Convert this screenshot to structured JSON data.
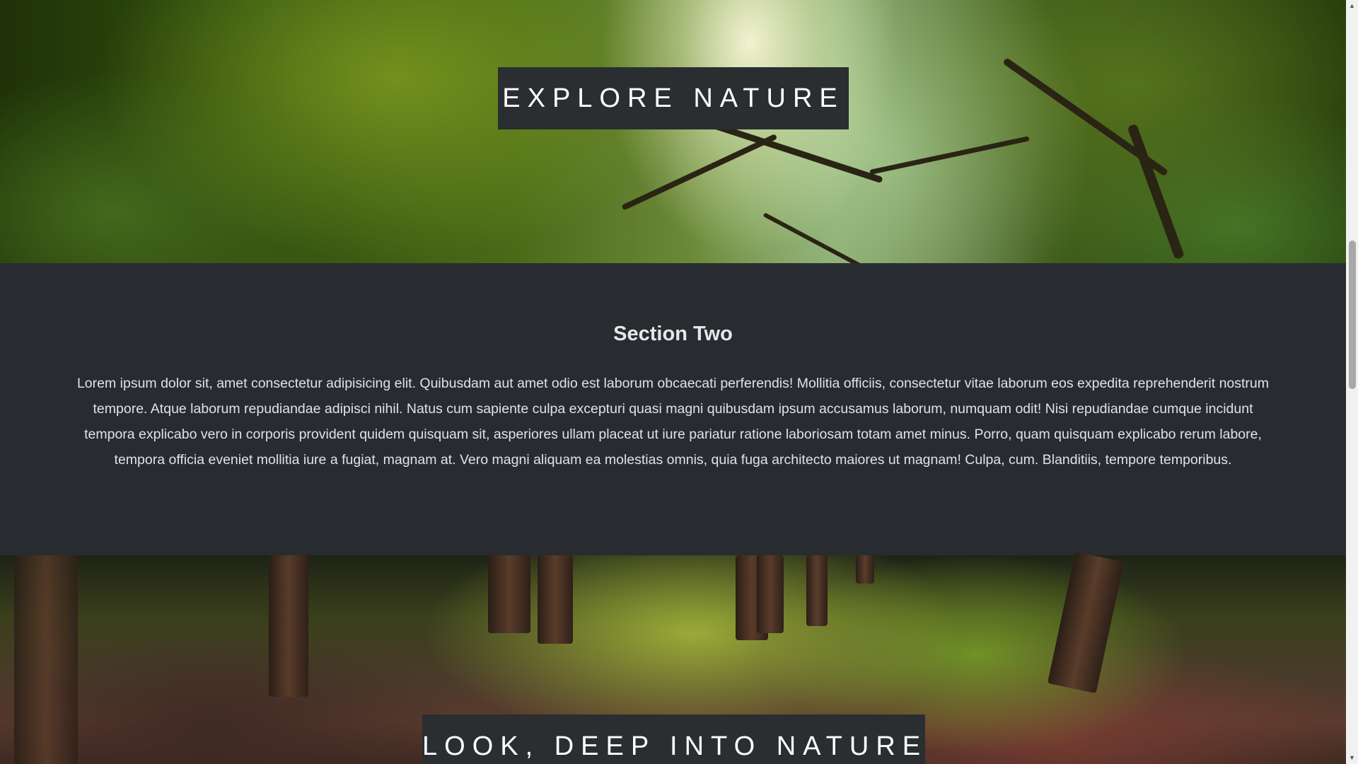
{
  "hero_top": {
    "title": "EXPLORE NATURE"
  },
  "section_two": {
    "heading": "Section Two",
    "body": "Lorem ipsum dolor sit, amet consectetur adipisicing elit. Quibusdam aut amet odio est laborum obcaecati perferendis! Mollitia officiis, consectetur vitae laborum eos expedita reprehenderit nostrum tempore. Atque laborum repudiandae adipisci nihil. Natus cum sapiente culpa excepturi quasi magni quibusdam ipsum accusamus laborum, numquam odit! Nisi repudiandae cumque incidunt tempora explicabo vero in corporis provident quidem quisquam sit, asperiores ullam placeat ut iure pariatur ratione laboriosam totam amet minus. Porro, quam quisquam explicabo rerum labore, tempora officia eveniet mollitia iure a fugiat, magnam at. Vero magni aliquam ea molestias omnis, quia fuga architecto maiores ut magnam! Culpa, cum. Blanditiis, tempore temporibus."
  },
  "hero_bottom": {
    "title": "LOOK, DEEP INTO NATURE"
  },
  "scrollbar": {
    "up_icon": "▲",
    "down_icon": "▼"
  },
  "colors": {
    "section_background": "#282c31",
    "title_box_background": "#2b2e31"
  }
}
